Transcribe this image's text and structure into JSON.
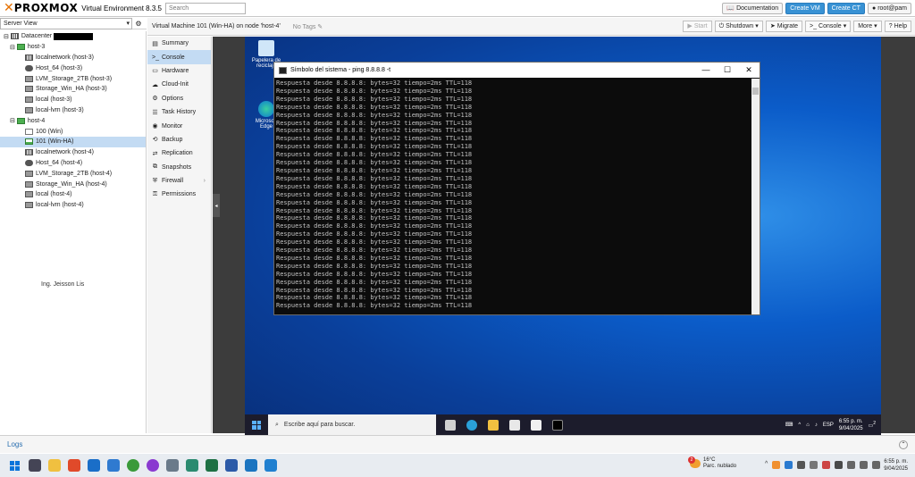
{
  "header": {
    "brand_x": "✕",
    "brand_text": "PROXMOX",
    "product": "Virtual Environment 8.3.5",
    "search_placeholder": "Search",
    "documentation": "Documentation",
    "create_vm": "Create VM",
    "create_ct": "Create CT",
    "user": "root@pam"
  },
  "tree": {
    "view": "Server View",
    "datacenter": "Datacenter",
    "nodes": [
      {
        "label": "host-3",
        "kind": "node"
      },
      {
        "label": "localnetwork (host-3)",
        "kind": "net"
      },
      {
        "label": "Host_64 (host-3)",
        "kind": "cloud"
      },
      {
        "label": "LVM_Storage_2TB (host-3)",
        "kind": "store"
      },
      {
        "label": "Storage_Win_HA (host-3)",
        "kind": "store"
      },
      {
        "label": "local (host-3)",
        "kind": "store"
      },
      {
        "label": "local-lvm (host-3)",
        "kind": "store"
      },
      {
        "label": "host-4",
        "kind": "node"
      },
      {
        "label": "100 (Win)",
        "kind": "vm"
      },
      {
        "label": "101 (Win-HA)",
        "kind": "vmrun"
      },
      {
        "label": "localnetwork (host-4)",
        "kind": "net"
      },
      {
        "label": "Host_64 (host-4)",
        "kind": "cloud"
      },
      {
        "label": "LVM_Storage_2TB (host-4)",
        "kind": "store"
      },
      {
        "label": "Storage_Win_HA (host-4)",
        "kind": "store"
      },
      {
        "label": "local (host-4)",
        "kind": "store"
      },
      {
        "label": "local-lvm (host-4)",
        "kind": "store"
      }
    ],
    "author": "Ing. Jeisson Lis"
  },
  "vm": {
    "title": "Virtual Machine 101 (Win-HA) on node 'host-4'",
    "tags": "No Tags",
    "actions": {
      "start": "Start",
      "shutdown": "Shutdown",
      "migrate": "Migrate",
      "console": "Console",
      "more": "More",
      "help": "Help"
    },
    "nav": [
      "Summary",
      "Console",
      "Hardware",
      "Cloud-Init",
      "Options",
      "Task History",
      "Monitor",
      "Backup",
      "Replication",
      "Snapshots",
      "Firewall",
      "Permissions"
    ],
    "nav_icons": [
      "▤",
      ">_",
      "▭",
      "☁",
      "⚙",
      "☰",
      "◉",
      "⟲",
      "⇄",
      "⧉",
      "⛨",
      "⚿"
    ]
  },
  "desktop": {
    "icon1": "Papelera de reciclaje",
    "icon2": "Microsoft Edge",
    "cmd_title": "Símbolo del sistema - ping  8.8.8.8 -t",
    "ping_line": "Respuesta desde 8.8.8.8: bytes=32 tiempo=2ms TTL=118",
    "ping_count": 29,
    "search_text": "Escribe aquí para buscar.",
    "lang": "ESP",
    "time": "6:55 p. m.",
    "date": "9/04/2025",
    "notif": "2"
  },
  "logs": {
    "title": "Logs"
  },
  "host": {
    "weather_temp": "16°C",
    "weather_text": "Parc. nublado",
    "weather_badge": "2",
    "time": "6:55 p. m.",
    "date": "9/04/2025"
  }
}
